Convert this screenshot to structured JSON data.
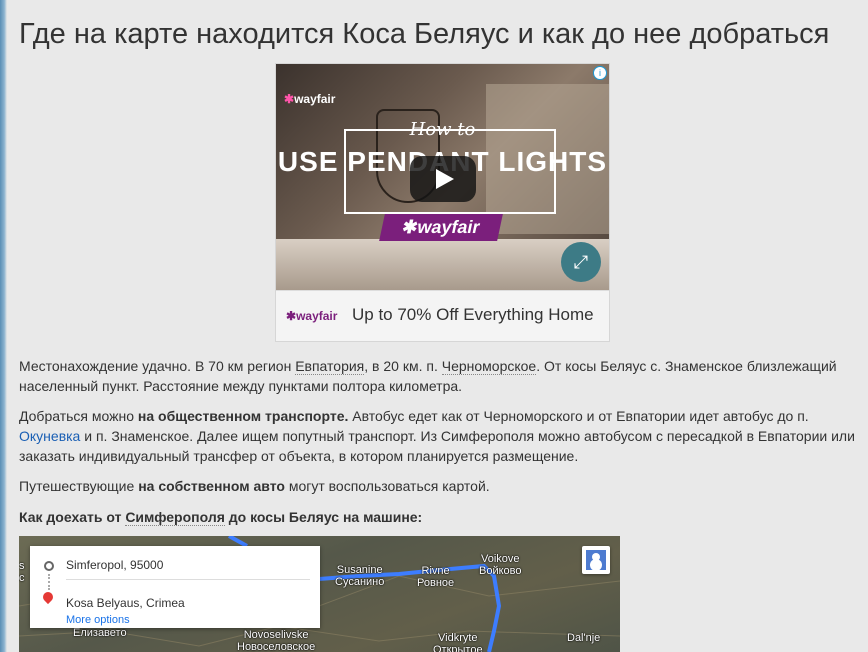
{
  "page": {
    "title": "Где на карте находится Коса Беляус и как до нее добраться"
  },
  "ad": {
    "info_icon": "i",
    "video_brand": "wayfair",
    "how_to": "How to",
    "headline": "USE PENDANT LIGHTS",
    "video_badge": "wayfair",
    "bar_brand": "wayfair",
    "offer": "Up to 70% Off Everything Home",
    "icons": [
      "info-icon",
      "play-icon",
      "fullscreen-icon"
    ],
    "colors": {
      "brand_purple": "#7b1f7c",
      "fullscreen_teal": "#3d7b86"
    }
  },
  "paragraphs": {
    "p1": {
      "t1": "Местонахождение удачно. В 70 км регион ",
      "link1": "Евпатория",
      "t2": ", в 20 км. п. ",
      "link2": "Черноморское",
      "t3": ". От косы Беляус с. Знаменское близлежащий населенный пункт. Расстояние между пунктами полтора километра."
    },
    "p2": {
      "t1": "Добраться можно ",
      "bold1": "на общественном транспорте.",
      "t2": " Автобус едет как от Черноморского и от Евпатории идет автобус до п. ",
      "link1": "Окуневка",
      "t3": " и п. Знаменское. Далее ищем попутный транспорт. Из Симферополя можно автобусом с пересадкой в Евпатории или заказать индивидуальный трансфер от объекта, в котором планируется размещение."
    },
    "p3": {
      "t1": "Путешествующие ",
      "bold1": "на собственном авто",
      "t2": " могут воспользоваться картой."
    },
    "p4": {
      "bold1": "Как доехать от ",
      "link1": "Симферополя",
      "bold2": " до косы Беляус на машине:"
    }
  },
  "map": {
    "origin": "Simferopol, 95000",
    "destination": "Kosa Belyaus, Crimea",
    "more_options": "More options",
    "labels": {
      "susanine_en": "Susanine",
      "susanine_ru": "Сусанино",
      "rivne_en": "Rivne",
      "rivne_ru": "Ровное",
      "voikove_en": "Voikove",
      "voikove_ru": "Войково",
      "elizavetovo": "Елизавето",
      "novoselivske_en": "Novoselivske",
      "novoselivske_ru": "Новоселовское",
      "vidkryte_en": "Vidkryte",
      "vidkryte_ru": "Открытое",
      "dalnie": "Dal'nje",
      "left_edge_1": "s",
      "left_edge_2": "с"
    },
    "route_color": "#3d7dff"
  }
}
